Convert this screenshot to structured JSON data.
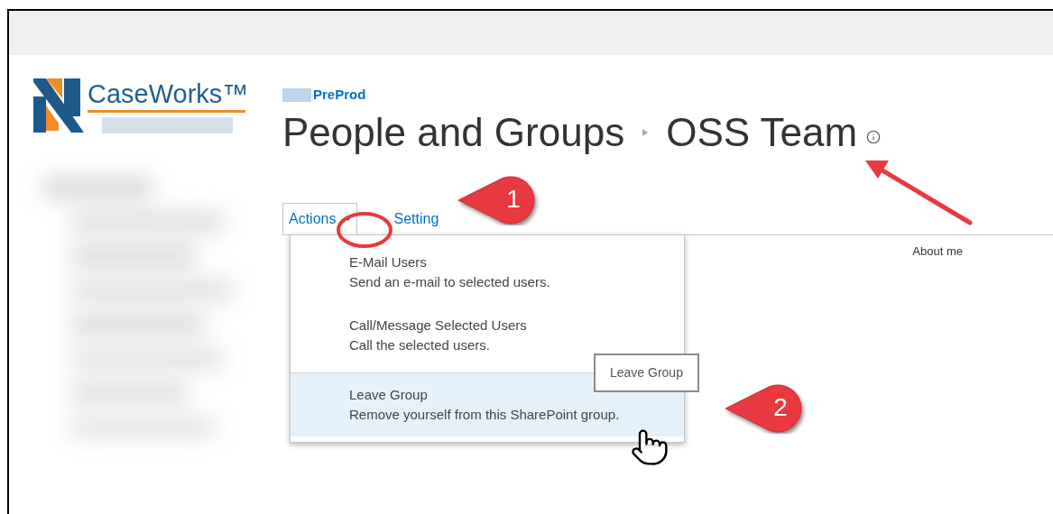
{
  "logo": {
    "text": "CaseWorks™"
  },
  "breadcrumb": {
    "site": "PreProd"
  },
  "title": {
    "parts": [
      "People and Groups",
      "OSS Team"
    ]
  },
  "toolbar": {
    "actions": {
      "label": "Actions",
      "expanded": true
    },
    "settings": {
      "label": "Setting"
    }
  },
  "menu": {
    "items": [
      {
        "title": "E-Mail Users",
        "description": "Send an e-mail to selected users.",
        "selected": false
      },
      {
        "title": "Call/Message Selected Users",
        "description": "Call the selected users.",
        "selected": false
      },
      {
        "title": "Leave Group",
        "description": "Remove yourself from this SharePoint group.",
        "selected": true
      }
    ]
  },
  "tooltip": "Leave Group",
  "column_header": "About me",
  "annotations": [
    {
      "number": "1"
    },
    {
      "number": "2"
    }
  ]
}
